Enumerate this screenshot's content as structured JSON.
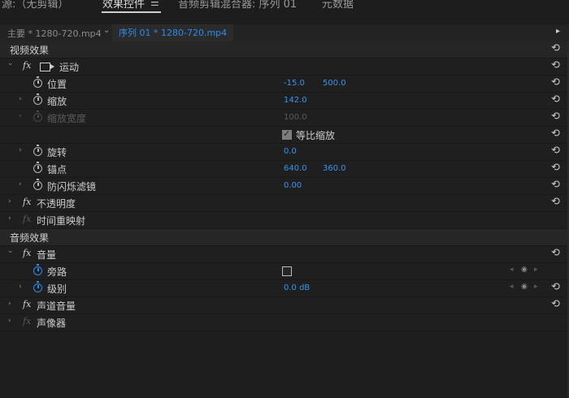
{
  "top_tabs": {
    "source": "源:（无剪辑）",
    "effect_controls": "效果控件",
    "audio_mixer": "音频剪辑混合器: 序列 01",
    "metadata": "元数据",
    "menu_icon": "☰"
  },
  "sequence_bar": {
    "master": "主要 * 1280-720.mp4",
    "chevron": "⌄",
    "sequence": "序列 01 * 1280-720.mp4",
    "arrow": "▸"
  },
  "video_section": {
    "label": "视频效果"
  },
  "motion": {
    "name": "运动",
    "position": {
      "label": "位置",
      "x": "-15.0",
      "y": "500.0"
    },
    "scale": {
      "label": "缩放",
      "value": "142.0"
    },
    "scale_width": {
      "label": "缩放宽度",
      "value": "100.0"
    },
    "uniform_scale": {
      "label": "等比缩放",
      "checked": true
    },
    "rotation": {
      "label": "旋转",
      "value": "0.0"
    },
    "anchor": {
      "label": "锚点",
      "x": "640.0",
      "y": "360.0"
    },
    "anti_flicker": {
      "label": "防闪烁滤镜",
      "value": "0.00"
    }
  },
  "opacity": {
    "name": "不透明度"
  },
  "time_remap": {
    "name": "时间重映射"
  },
  "audio_section": {
    "label": "音频效果"
  },
  "volume": {
    "name": "音量",
    "bypass": {
      "label": "旁路",
      "checked": false
    },
    "level": {
      "label": "级别",
      "value": "0.0 dB"
    }
  },
  "channel_volume": {
    "name": "声道音量"
  },
  "panner": {
    "name": "声像器"
  },
  "glyphs": {
    "fx": "fx",
    "twirl_closed": "›",
    "twirl_open": "⌄",
    "reset": "⟲",
    "kf_prev": "◂",
    "kf_add": "◉",
    "kf_next": "▸"
  },
  "colors": {
    "accent": "#2d8ceb",
    "background": "#1e1e1e",
    "section": "#262626"
  }
}
